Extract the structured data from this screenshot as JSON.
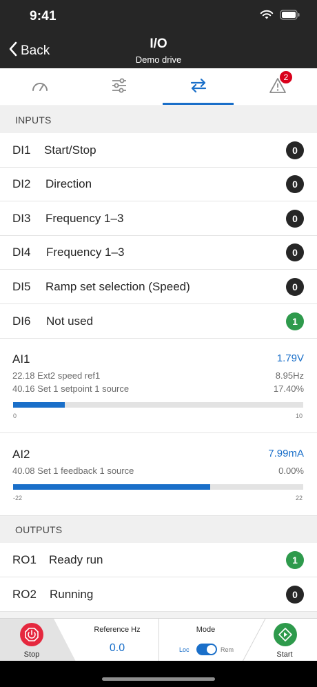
{
  "status_bar": {
    "time": "9:41"
  },
  "nav": {
    "back_label": "Back",
    "title": "I/O",
    "subtitle": "Demo drive"
  },
  "tabs": [
    {
      "icon": "gauge-icon",
      "active": false
    },
    {
      "icon": "sliders-icon",
      "active": false
    },
    {
      "icon": "swap-arrows-icon",
      "active": true
    },
    {
      "icon": "warning-icon",
      "active": false,
      "badge": "2"
    }
  ],
  "inputs": {
    "header": "INPUTS",
    "digital": [
      {
        "id": "DI1",
        "label": "Start/Stop",
        "value": "0",
        "on": false
      },
      {
        "id": "DI2",
        "label": "Direction",
        "value": "0",
        "on": false
      },
      {
        "id": "DI3",
        "label": "Frequency 1–3",
        "value": "0",
        "on": false
      },
      {
        "id": "DI4",
        "label": "Frequency 1–3",
        "value": "0",
        "on": false
      },
      {
        "id": "DI5",
        "label": "Ramp set selection (Speed)",
        "value": "0",
        "on": false
      },
      {
        "id": "DI6",
        "label": "Not used",
        "value": "1",
        "on": true
      }
    ],
    "analog": [
      {
        "id": "AI1",
        "value": "1.79V",
        "params": [
          {
            "label": "22.18 Ext2 speed ref1",
            "value": "8.95Hz"
          },
          {
            "label": "40.16 Set 1 setpoint 1 source",
            "value": "17.40%"
          }
        ],
        "scale_min": "0",
        "scale_max": "10",
        "level": 0.179
      },
      {
        "id": "AI2",
        "value": "7.99mA",
        "params": [
          {
            "label": "40.08 Set 1 feedback 1 source",
            "value": "0.00%"
          }
        ],
        "scale_min": "-22",
        "scale_max": "22",
        "level": 0.68
      }
    ]
  },
  "outputs": {
    "header": "OUTPUTS",
    "relays": [
      {
        "id": "RO1",
        "label": "Ready run",
        "value": "1",
        "on": true
      },
      {
        "id": "RO2",
        "label": "Running",
        "value": "0",
        "on": false
      }
    ]
  },
  "control_bar": {
    "stop_label": "Stop",
    "reference_label": "Reference Hz",
    "reference_value": "0.0",
    "mode_label": "Mode",
    "mode_loc": "Loc",
    "mode_rem": "Rem",
    "start_label": "Start"
  },
  "colors": {
    "accent": "#1a6fc9",
    "on": "#2e9a4c",
    "off": "#262626",
    "stop": "#e5283e",
    "start": "#2e9a4c",
    "badge": "#d9001b"
  }
}
